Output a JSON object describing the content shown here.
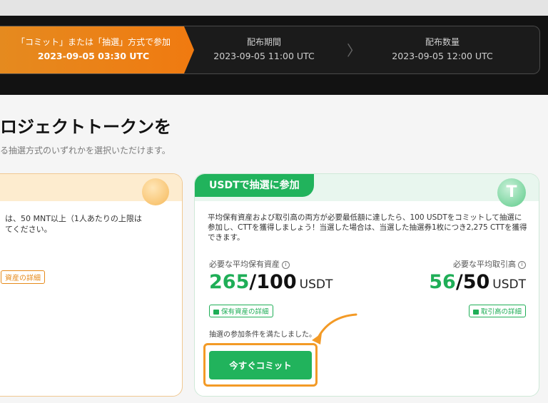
{
  "stepper": {
    "steps": [
      {
        "label": "「コミット」または「抽選」方式で参加",
        "date": "2023-09-05 03:30 UTC",
        "active": true
      },
      {
        "label": "配布期間",
        "date": "2023-09-05 11:00 UTC",
        "active": false
      },
      {
        "label": "配布数量",
        "date": "2023-09-05 12:00 UTC",
        "active": false
      }
    ],
    "accent_color": "#f07a10"
  },
  "heading": {
    "title": "ロジェクトトークンを",
    "subtitle": "る抽選方式のいずれかを選択いただけます。"
  },
  "left_card": {
    "description": "は、50 MNT以上（1人あたりの上限は\nてください。",
    "link": "資産の詳細"
  },
  "right_card": {
    "badge": "USDTで抽選に参加",
    "coin_symbol": "T",
    "description": "平均保有資産および取引高の両方が必要最低額に達したら、100 USDTをコミットして抽選に参加し、CTTを獲得しましょう！当選した場合は、当選した抽選券1枚につき2,275 CTTを獲得できます。",
    "holding": {
      "label": "必要な平均保有資産",
      "current": "265",
      "separator": "/",
      "required": "100",
      "unit": "USDT",
      "link": "保有資産の詳細"
    },
    "volume": {
      "label": "必要な平均取引高",
      "current": "56",
      "separator": "/",
      "required": "50",
      "unit": "USDT",
      "link": "取引高の詳細"
    },
    "status": "抽選の参加条件を満たしました。",
    "commit_button": "今すぐコミット",
    "brand_color": "#21b35c"
  }
}
